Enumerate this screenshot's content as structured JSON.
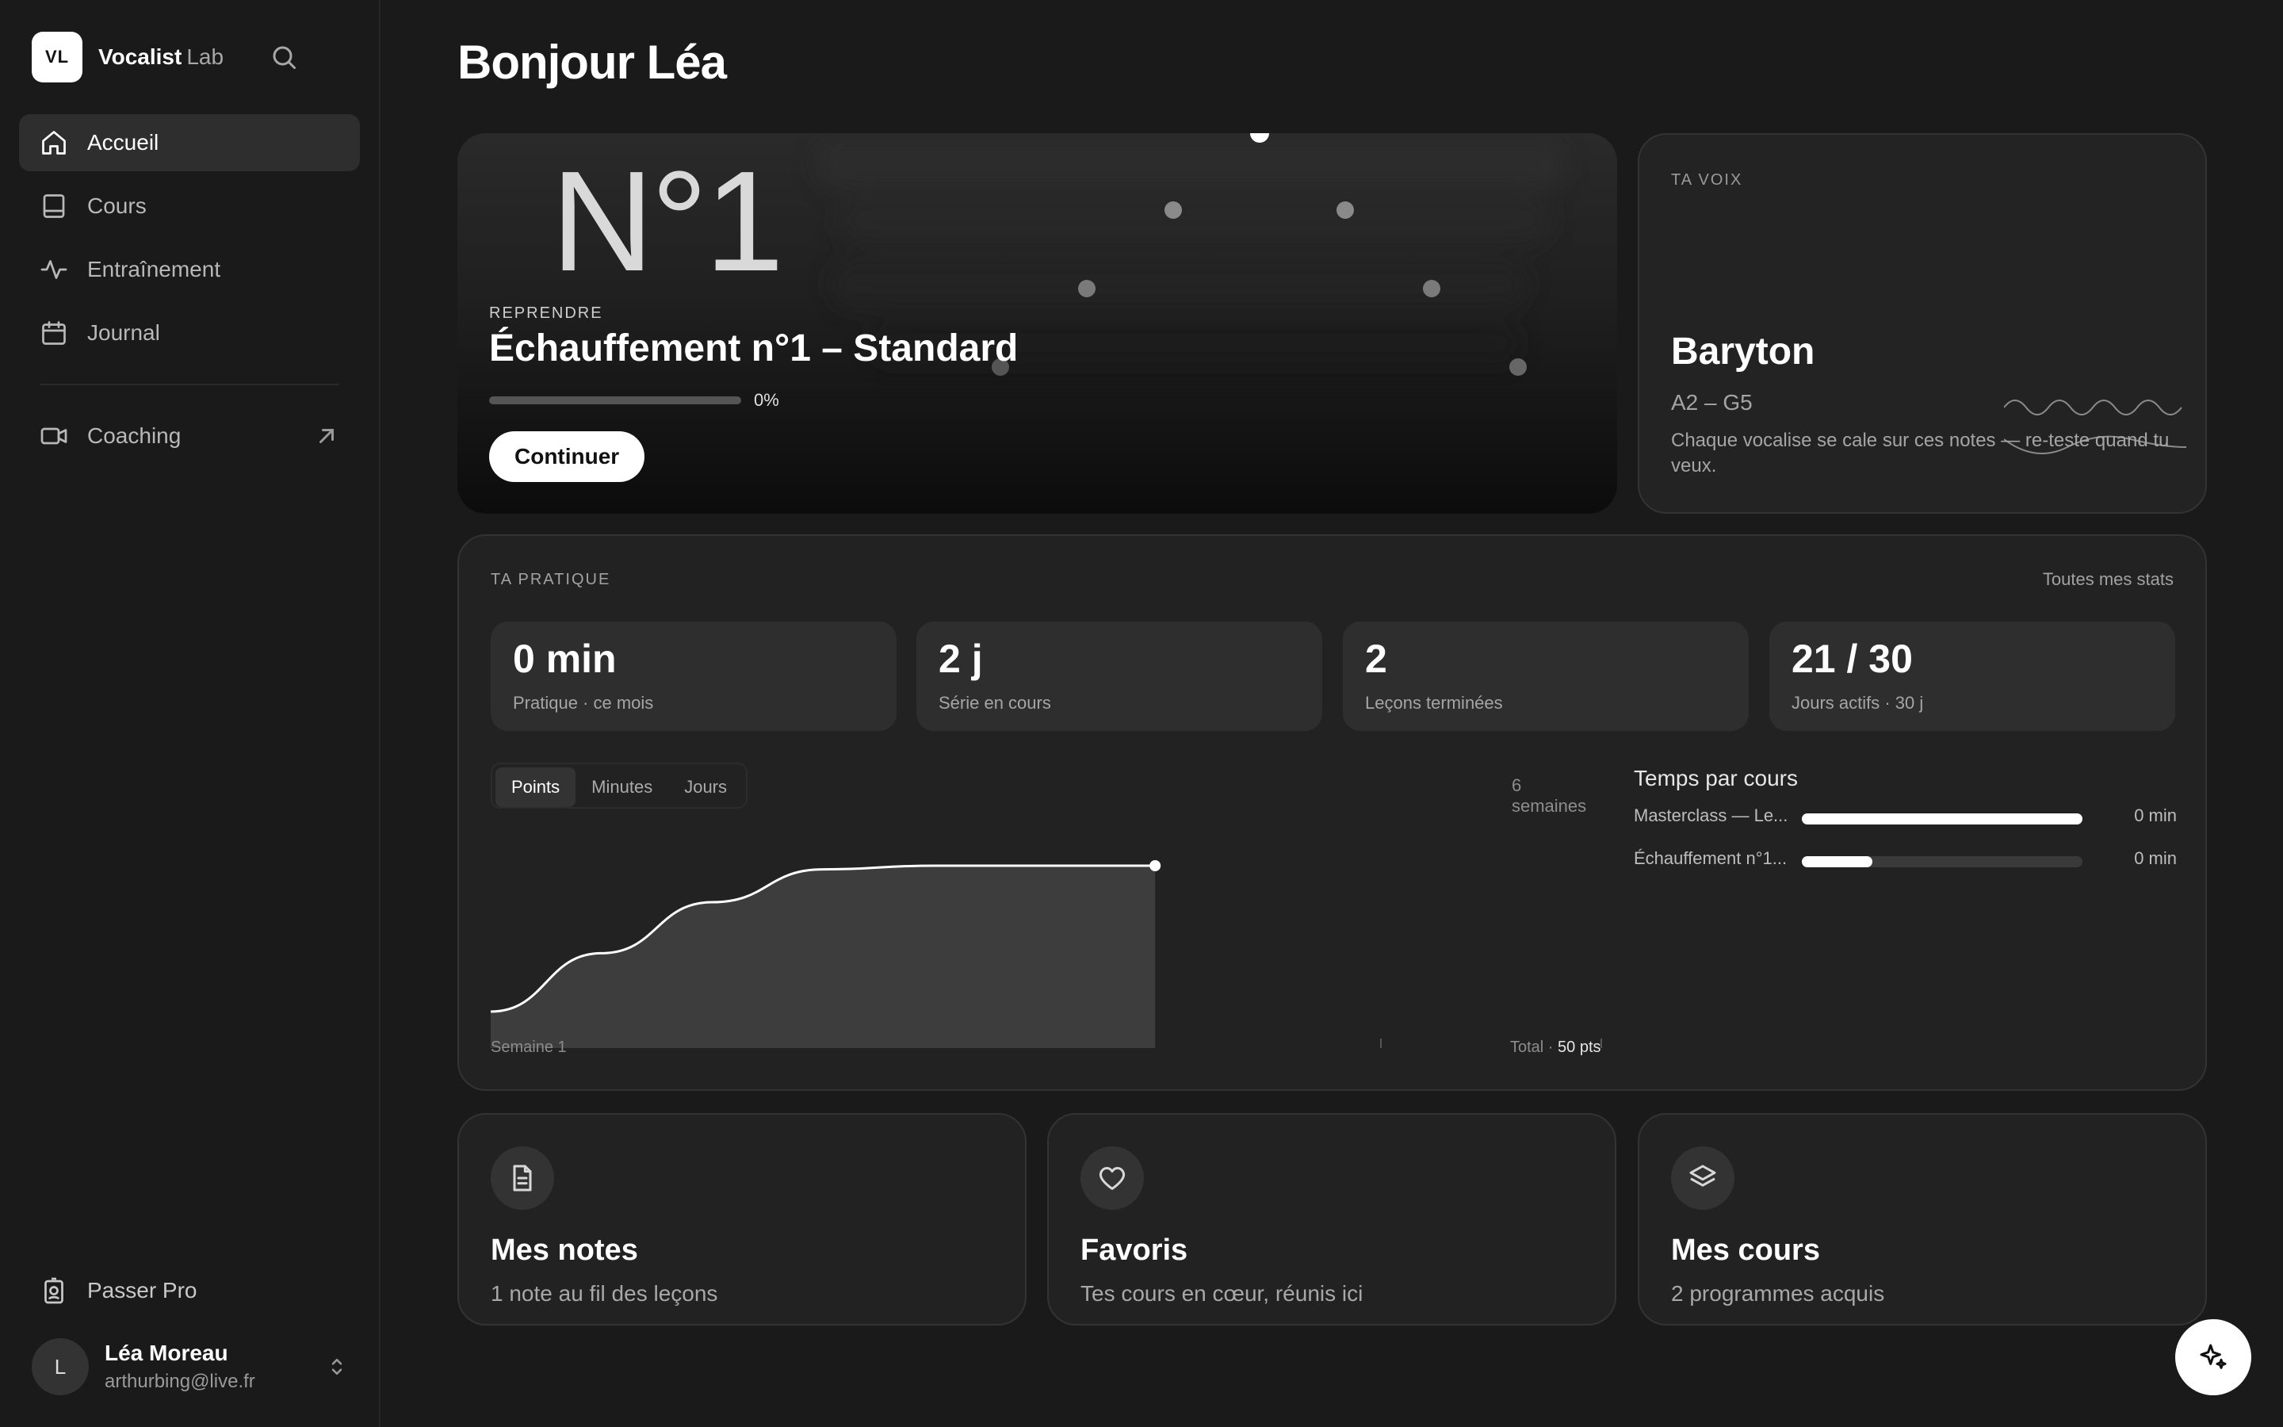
{
  "brand": {
    "logo_text": "VL",
    "name": "Vocalist",
    "sub": "Lab"
  },
  "sidebar": {
    "items": [
      {
        "label": "Accueil",
        "icon": "home-icon",
        "active": true
      },
      {
        "label": "Cours",
        "icon": "book-icon"
      },
      {
        "label": "Entraînement",
        "icon": "activity-icon"
      },
      {
        "label": "Journal",
        "icon": "calendar-icon"
      }
    ],
    "coaching": {
      "label": "Coaching",
      "icon": "video-icon"
    },
    "passer_pro": {
      "label": "Passer Pro",
      "icon": "badge-icon"
    },
    "user": {
      "initial": "L",
      "name": "Léa Moreau",
      "email": "arthurbing@live.fr"
    }
  },
  "page": {
    "title": "Bonjour Léa"
  },
  "hero": {
    "number": "N°1",
    "kicker": "REPRENDRE",
    "title": "Échauffement n°1 – Standard",
    "progress": 0,
    "progress_label": "0%",
    "button": "Continuer"
  },
  "voice": {
    "kicker": "TA VOIX",
    "type": "Baryton",
    "range": "A2 – G5",
    "desc": "Chaque vocalise se cale sur ces notes — re-teste quand tu veux."
  },
  "practice": {
    "kicker": "TA PRATIQUE",
    "link": "Toutes mes stats",
    "stats": [
      {
        "value": "0 min",
        "label": "Pratique · ce mois"
      },
      {
        "value": "2 j",
        "label": "Série en cours"
      },
      {
        "value": "2",
        "label": "Leçons terminées"
      },
      {
        "value": "21 / 30",
        "label": "Jours actifs · 30 j"
      }
    ],
    "tabs": [
      "Points",
      "Minutes",
      "Jours"
    ],
    "active_tab": "Points",
    "period": "6 semaines",
    "x_label_first": "Semaine 1",
    "total_label": "Total ·",
    "total_value": "50 pts",
    "time_by_course": {
      "title": "Temps par cours",
      "rows": [
        {
          "name": "Masterclass — Le...",
          "fraction": 1.0,
          "value": "0 min"
        },
        {
          "name": "Échauffement n°1...",
          "fraction": 0.25,
          "value": "0 min"
        }
      ]
    }
  },
  "chart_data": {
    "type": "area",
    "x": [
      0,
      0.5,
      1,
      1.5,
      2,
      2.5,
      3
    ],
    "values": [
      10,
      26,
      40,
      49,
      50,
      50,
      50
    ],
    "ylim": [
      0,
      60
    ],
    "xlim": [
      0,
      5
    ],
    "grid": false
  },
  "cards": [
    {
      "title": "Mes notes",
      "sub": "1 note au fil des leçons",
      "icon": "note-icon"
    },
    {
      "title": "Favoris",
      "sub": "Tes cours en cœur, réunis ici",
      "icon": "heart-icon"
    },
    {
      "title": "Mes cours",
      "sub": "2 programmes acquis",
      "icon": "layers-icon"
    }
  ],
  "fab": {
    "icon": "sparkle-icon"
  },
  "colors": {
    "background": "#1a1a1a",
    "card": "#222222",
    "accent": "#ffffff"
  }
}
